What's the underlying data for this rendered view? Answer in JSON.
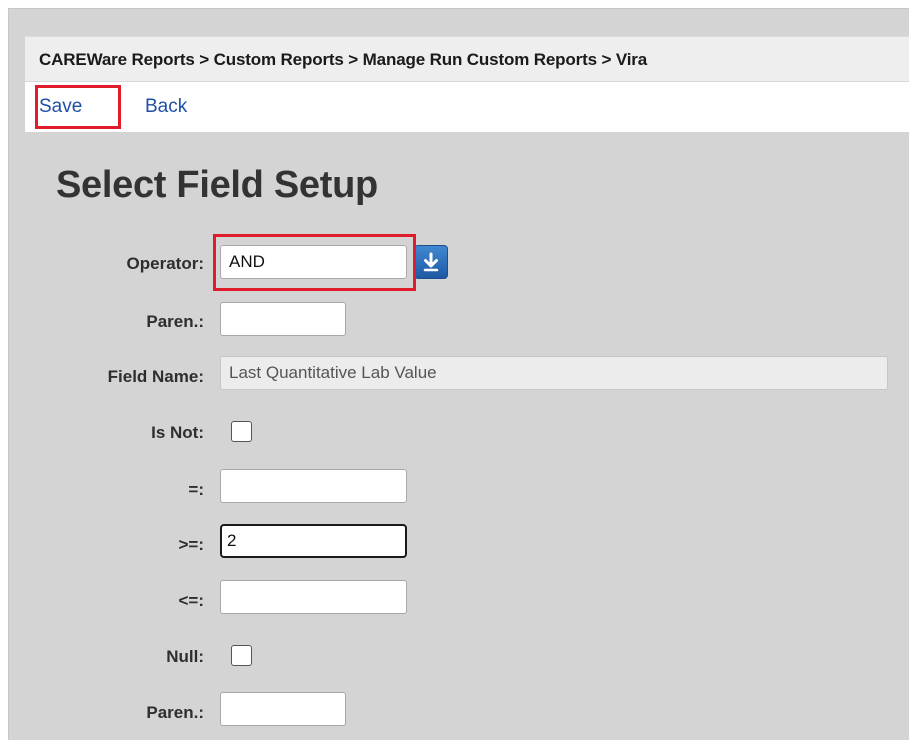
{
  "breadcrumb": {
    "text": "CAREWare Reports > Custom Reports > Manage Run Custom Reports > Vira"
  },
  "actions": {
    "save_label": "Save",
    "back_label": "Back"
  },
  "page": {
    "title": "Select Field Setup"
  },
  "form": {
    "operator_label": "Operator:",
    "operator_value": "AND",
    "paren_open_label": "Paren.:",
    "paren_open_value": "",
    "field_name_label": "Field Name:",
    "field_name_value": "Last Quantitative Lab Value",
    "is_not_label": "Is Not:",
    "is_not_checked": false,
    "equals_label": "=:",
    "equals_value": "",
    "gte_label": ">=:",
    "gte_value": "2",
    "lte_label": "<=:",
    "lte_value": "",
    "null_label": "Null:",
    "null_checked": false,
    "paren_close_label": "Paren.:",
    "paren_close_value": ""
  },
  "icons": {
    "dropdown": "download-arrow-icon"
  },
  "colors": {
    "highlight": "#e01c2a",
    "link": "#1f4fa6",
    "dropdown_button": "#2a6fba",
    "background": "#d4d4d4"
  }
}
